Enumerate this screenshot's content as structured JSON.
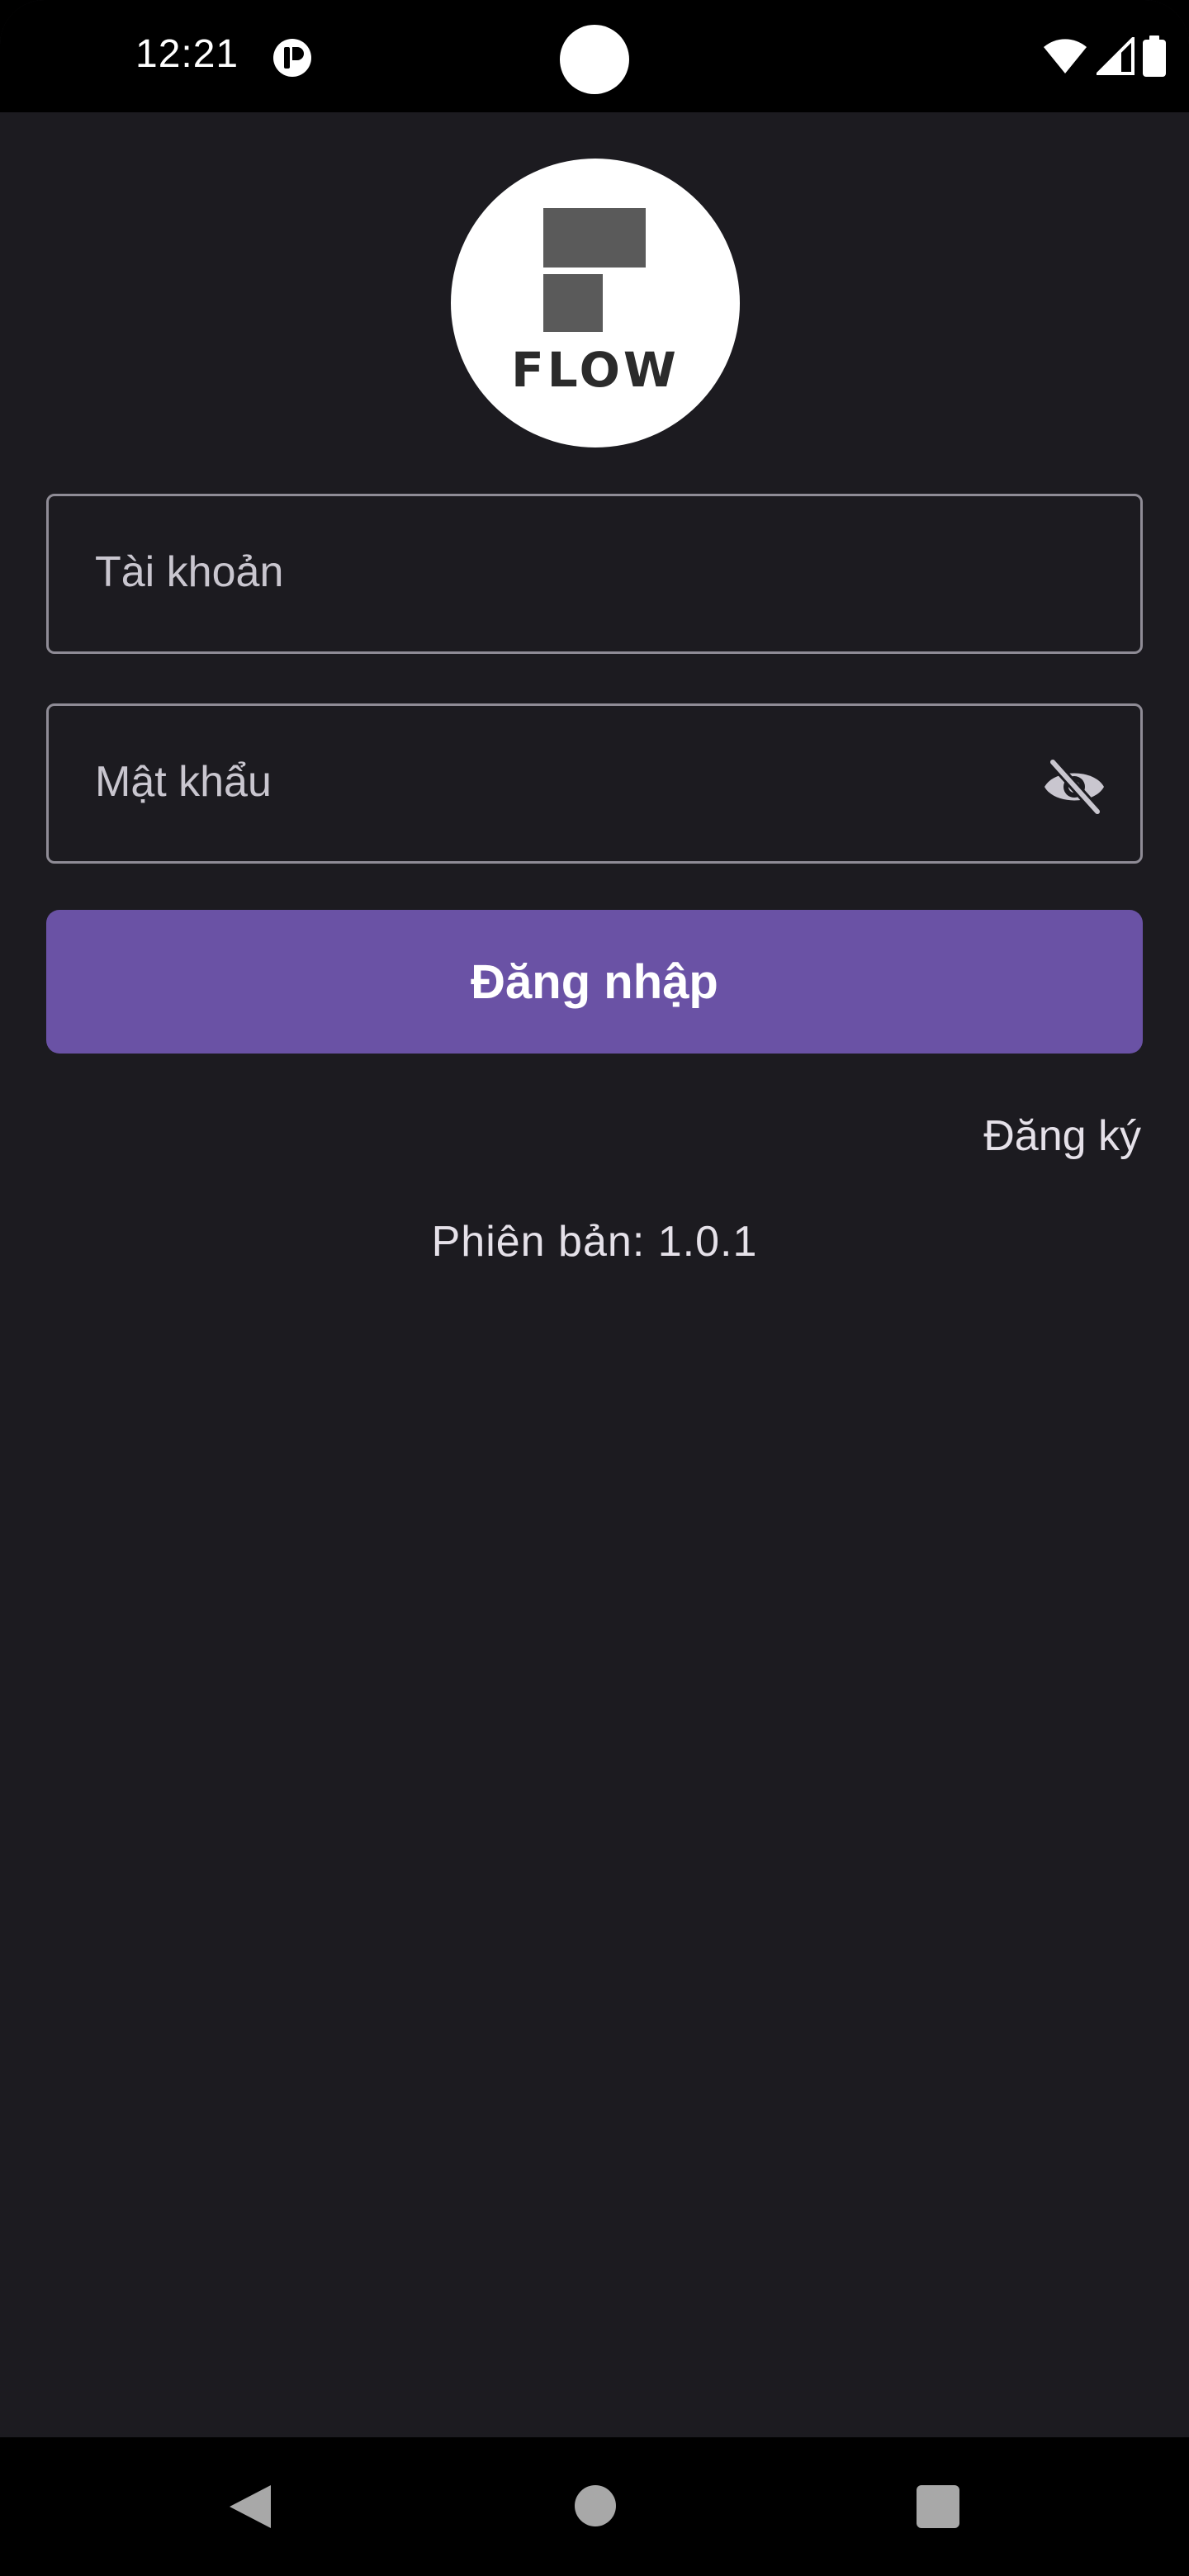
{
  "status_bar": {
    "time": "12:21",
    "app_icon": "notification-app-icon",
    "wifi_icon": "wifi-icon",
    "signal_icon": "cell-signal-icon",
    "battery_icon": "battery-icon"
  },
  "logo": {
    "text": "FLOW"
  },
  "form": {
    "username_placeholder": "Tài khoản",
    "password_placeholder": "Mật khẩu",
    "password_toggle_icon": "visibility-off-icon",
    "login_label": "Đăng nhập",
    "register_label": "Đăng ký"
  },
  "footer": {
    "version_text": "Phiên bản: 1.0.1"
  },
  "nav_bar": {
    "back_icon": "back-triangle-icon",
    "home_icon": "home-circle-icon",
    "recents_icon": "recents-square-icon"
  },
  "colors": {
    "background": "#1c1b20",
    "primary_button": "#6a52a5",
    "outline": "#8f8c96",
    "text": "#e5e1e9"
  }
}
